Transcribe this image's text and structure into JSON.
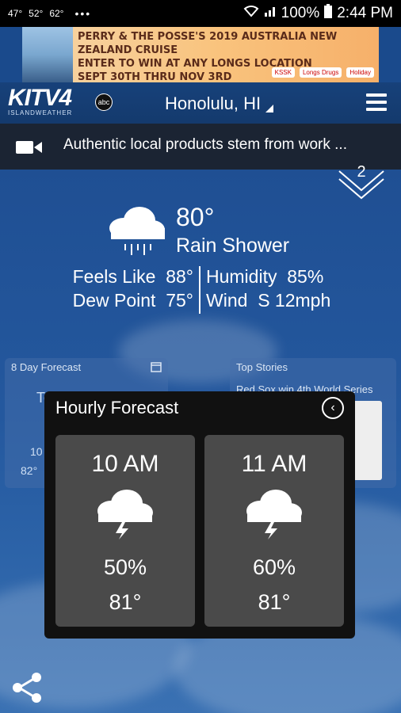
{
  "status_bar": {
    "temps": [
      "47°",
      "52°",
      "62°"
    ],
    "overflow": "•••",
    "battery": "100%",
    "time": "2:44 PM"
  },
  "ad": {
    "line1": "PERRY & THE POSSE'S 2019 AUSTRALIA NEW ZEALAND CRUISE",
    "line2": "ENTER TO WIN AT ANY LONGS LOCATION",
    "line3": "SEPT 30TH THRU NOV 3RD",
    "logos": [
      "KSSK",
      "Longs Drugs",
      "Holiday"
    ]
  },
  "header": {
    "brand": "KITV4",
    "brand_sub": "ISLANDWEATHER",
    "abc": "abc",
    "city": "Honolulu, HI"
  },
  "news": {
    "headline": "Authentic local products stem from work ..."
  },
  "alerts": {
    "count": "2"
  },
  "current": {
    "temp": "80°",
    "condition": "Rain Shower",
    "feels_like_label": "Feels Like",
    "feels_like": "88°",
    "humidity_label": "Humidity",
    "humidity": "85%",
    "dew_point_label": "Dew Point",
    "dew_point": "75°",
    "wind_label": "Wind",
    "wind": "S 12mph"
  },
  "background_panels": {
    "eight_day": "8 Day Forecast",
    "top_stories": "Top Stories",
    "story": "Red Sox win 4th World Series",
    "eight_day_values": [
      "To",
      "10",
      "82°"
    ]
  },
  "hourly": {
    "title": "Hourly Forecast",
    "items": [
      {
        "time": "10 AM",
        "precip": "50%",
        "temp": "81°"
      },
      {
        "time": "11 AM",
        "precip": "60%",
        "temp": "81°"
      }
    ]
  }
}
